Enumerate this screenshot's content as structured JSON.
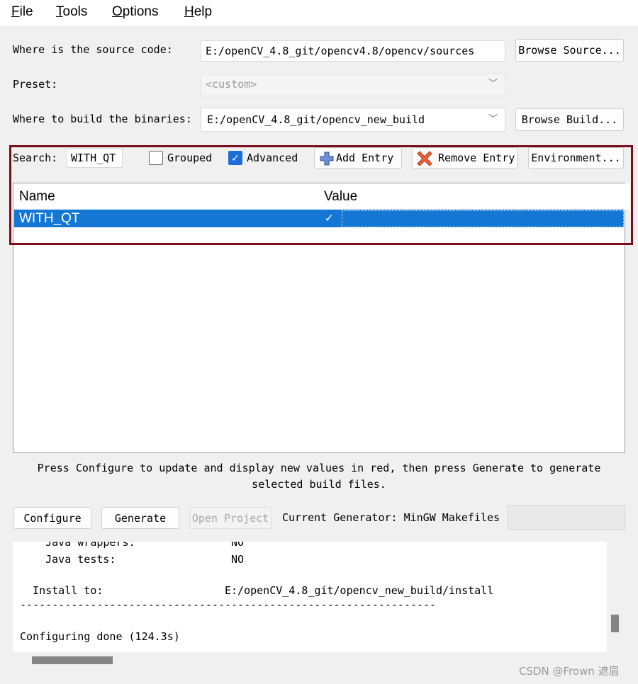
{
  "menu": [
    {
      "pre": "",
      "u": "F",
      "post": "ile"
    },
    {
      "pre": "",
      "u": "T",
      "post": "ools"
    },
    {
      "pre": "",
      "u": "O",
      "post": "ptions"
    },
    {
      "pre": "",
      "u": "H",
      "post": "elp"
    }
  ],
  "source": {
    "label": "Where is the source code:",
    "value": "E:/openCV_4.8_git/opencv4.8/opencv/sources",
    "browse_label": "Browse Source..."
  },
  "preset": {
    "label": "Preset:",
    "value": "<custom>"
  },
  "build": {
    "label": "Where to build the binaries:",
    "value": "E:/openCV_4.8_git/opencv_new_build",
    "browse_label": "Browse Build..."
  },
  "search": {
    "label": "Search:",
    "value": "WITH_QT",
    "grouped_label": "Grouped",
    "grouped_checked": false,
    "advanced_label": "Advanced",
    "advanced_checked": true,
    "add_entry_label": "Add Entry",
    "remove_entry_label": "Remove Entry",
    "environment_label": "Environment..."
  },
  "table": {
    "columns": [
      "Name",
      "Value"
    ],
    "rows": [
      {
        "name": "WITH_QT",
        "checked": true
      }
    ]
  },
  "hint": "Press Configure to update and display new values in red, then press Generate to generate selected build files.",
  "actions": {
    "configure_label": "Configure",
    "generate_label": "Generate",
    "open_project_label": "Open Project",
    "generator_text": "Current Generator: MinGW Makefiles"
  },
  "log": [
    "    Java wrappers:               NO",
    "    Java tests:                  NO",
    "",
    "  Install to:                   E:/openCV_4.8_git/opencv_new_build/install",
    "-----------------------------------------------------------------",
    "",
    "",
    "Configuring done (124.3s)"
  ],
  "watermark": "CSDN @Frown 遮眉",
  "colors": {
    "selection": "#1477d4",
    "highlight_frame": "#7a0f1b",
    "checkbox_on": "#1c6ed8"
  }
}
